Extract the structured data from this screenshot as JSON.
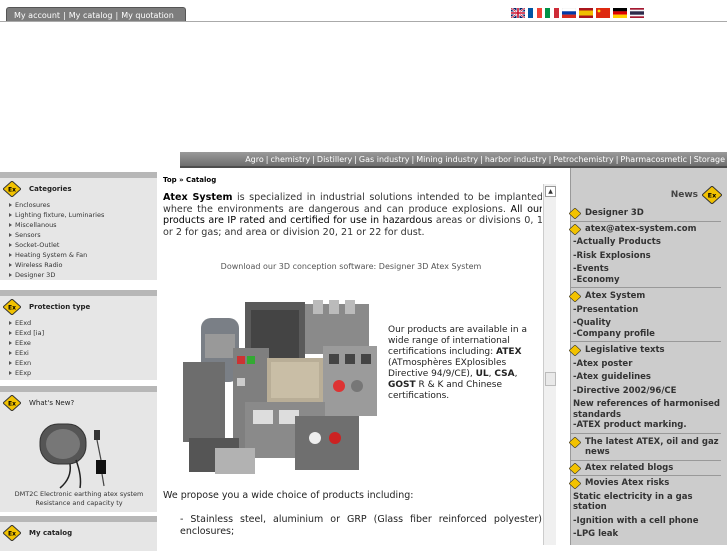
{
  "account_tabs": [
    "My account",
    "My catalog",
    "My quotation"
  ],
  "flags": [
    "uk",
    "france",
    "italy",
    "russia",
    "spain",
    "china",
    "germany",
    "thailand"
  ],
  "nav": [
    "Agro",
    "chemistry",
    "Distillery",
    "Gas industry",
    "Mining industry",
    "harbor industry",
    "Petrochemistry",
    "Pharmacosmetic",
    "Storage"
  ],
  "left": {
    "categories": {
      "title": "Categories",
      "items": [
        "Enclosures",
        "Lighting fixture, Luminaries",
        "Miscellanous",
        "Sensors",
        "Socket-Outlet",
        "Heating System & Fan",
        "Wireless Radio",
        "Designer 3D"
      ]
    },
    "protection": {
      "title": "Protection type",
      "items": [
        "EExd",
        "EExd [ia]",
        "EExe",
        "EExi",
        "EExn",
        "EExp"
      ]
    },
    "whats_new": {
      "title": "What's New?",
      "caption": "DMT2C Electronic earthing atex system Resistance and capacity ty"
    },
    "catalog": {
      "title": "My catalog"
    }
  },
  "main": {
    "breadcrumb": "Top » Catalog",
    "intro_bold": "Atex System",
    "intro_rest": " is specialized in industrial solutions intended to be implanted where the environments are dangerous and can produce explosions. ",
    "intro_black": "All our products are IP rated and certified for use in hazardous",
    "intro_tail": " areas or divisions 0, 1 or 2 for gas; and area or division 20, 21 or 22 for dust.",
    "download": "Download our 3D conception software: Designer 3D Atex System",
    "cert_a": "Our products are available in a wide range of international certifications including: ",
    "cert_atex": "ATEX",
    "cert_b": " (ATmosphères EXplosibles Directive 94/9/CE), ",
    "cert_ul": "UL",
    "cert_c": ", ",
    "cert_csa": "CSA",
    "cert_d": ", ",
    "cert_gost": "GOST",
    "cert_e": " R & K and Chinese certifications.",
    "propose": "We propose you a wide choice of products including:",
    "bullet1": "-     Stainless steel, aluminium or GRP (Glass fiber reinforced polyester) enclosures;"
  },
  "right": {
    "news_title": "News",
    "items": [
      {
        "type": "h",
        "text": "Designer 3D",
        "border": true
      },
      {
        "type": "h",
        "text": "atex@atex-system.com"
      },
      {
        "type": "s",
        "text": "-Actually Products"
      },
      {
        "type": "s",
        "text": "-Risk Explosions"
      },
      {
        "type": "s",
        "text": "-Events"
      },
      {
        "type": "d",
        "text": "-Economy"
      },
      {
        "type": "h",
        "text": "Atex System"
      },
      {
        "type": "s",
        "text": "-Presentation"
      },
      {
        "type": "s",
        "text": "-Quality"
      },
      {
        "type": "d",
        "text": "-Company profile"
      },
      {
        "type": "h",
        "text": "Legislative texts"
      },
      {
        "type": "s",
        "text": "-Atex poster"
      },
      {
        "type": "s",
        "text": "-Atex guidelines"
      },
      {
        "type": "s",
        "text": "-Directive 2002/96/CE"
      },
      {
        "type": "s",
        "text": " New references of harmonised standards"
      },
      {
        "type": "d",
        "text": "-ATEX product marking."
      },
      {
        "type": "h",
        "text": "The latest ATEX, oil and gaz news",
        "border": true
      },
      {
        "type": "h",
        "text": "Atex related blogs",
        "border": true
      },
      {
        "type": "h",
        "text": "Movies Atex risks"
      },
      {
        "type": "s",
        "text": " Static electricity in a gas station"
      },
      {
        "type": "s",
        "text": "-Ignition with a cell phone"
      },
      {
        "type": "s",
        "text": "-LPG leak"
      }
    ]
  },
  "colors": {
    "nav_bg": "#7a7a7a",
    "left_bg": "#e6e6e6",
    "right_bg": "#cccccc",
    "ex_yellow": "#f2c200"
  }
}
